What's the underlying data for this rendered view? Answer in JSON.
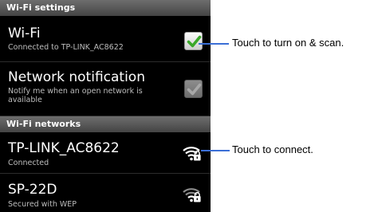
{
  "sections": {
    "wifi_settings": "Wi-Fi settings",
    "wifi_networks": "Wi-Fi networks"
  },
  "wifi": {
    "title": "Wi-Fi",
    "summary": "Connected to TP-LINK_AC8622",
    "checked": true
  },
  "notification": {
    "title": "Network notification",
    "summary": "Notify me when an open network is available",
    "checked": true
  },
  "networks": [
    {
      "ssid": "TP-LINK_AC8622",
      "status": "Connected",
      "icon": "wifi-lock-icon"
    },
    {
      "ssid": "SP-22D",
      "status": "Secured with WEP",
      "icon": "wifi-lock-icon"
    }
  ],
  "callouts": {
    "wifi_toggle": "Touch to turn on & scan.",
    "network_connect": "Touch to connect."
  },
  "colors": {
    "checkmark": "#3aa82a",
    "callout_line": "#3b6fd6",
    "header_bg": "#555555"
  }
}
